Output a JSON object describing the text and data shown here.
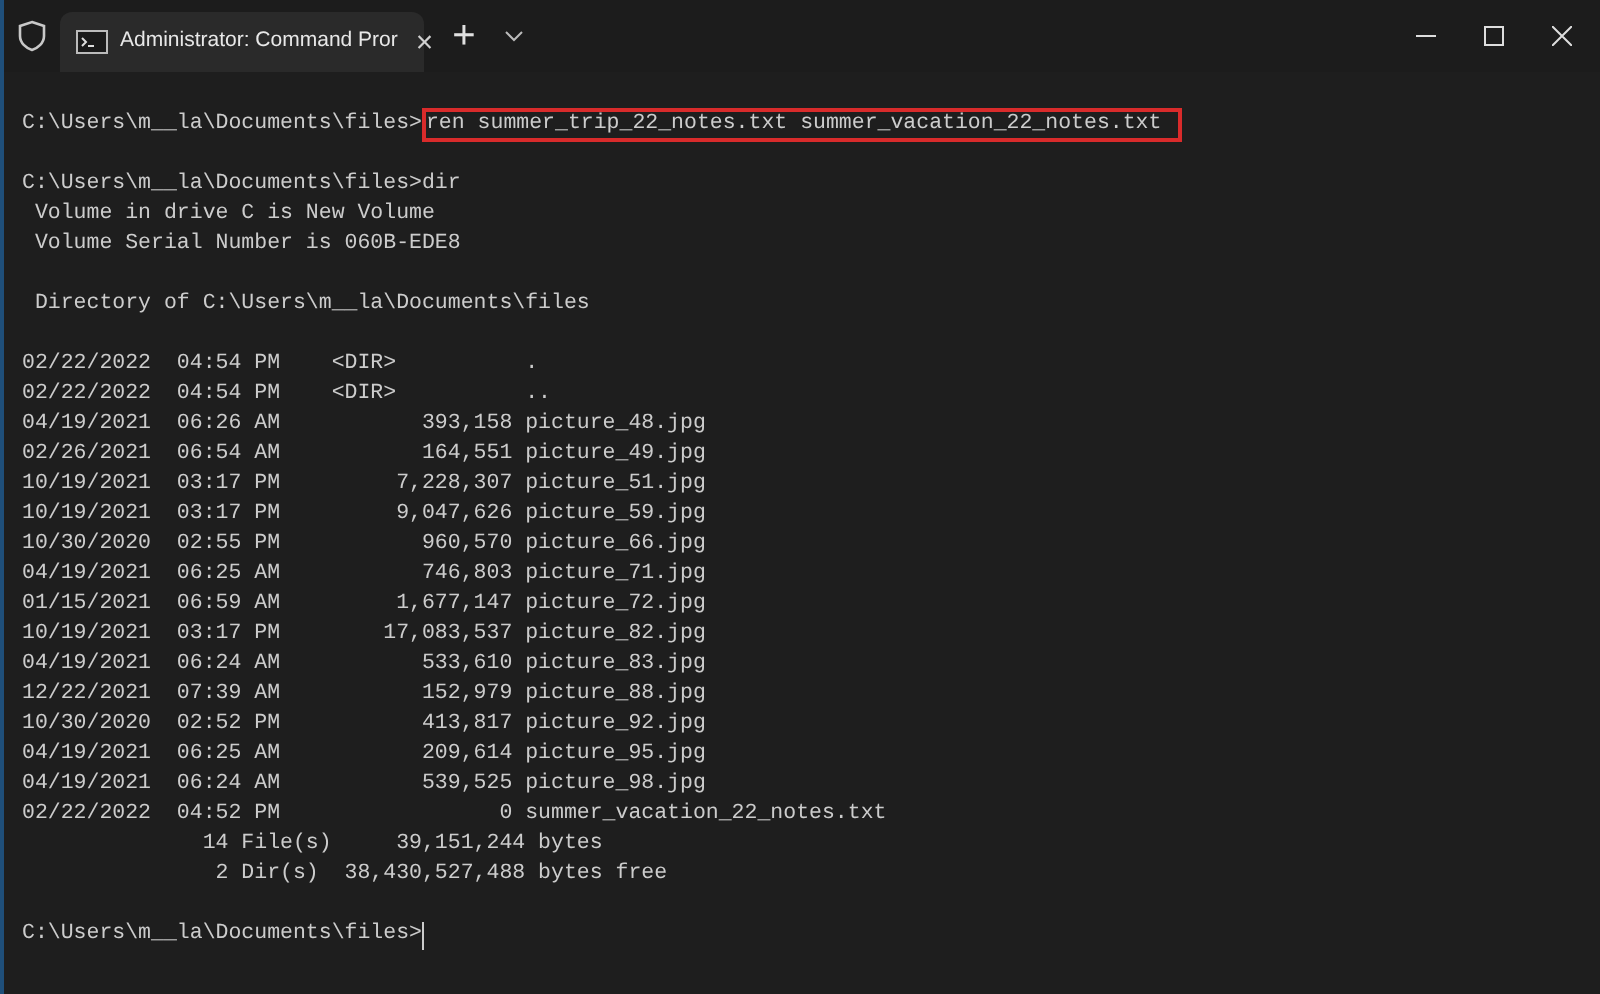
{
  "window": {
    "tab_title": "Administrator: Command Pror",
    "tab_close": "×",
    "new_tab": "+"
  },
  "lines": [
    {
      "kind": "blank"
    },
    {
      "kind": "prompt",
      "prompt": "C:\\Users\\m__la\\Documents\\files>",
      "command": "ren summer_trip_22_notes.txt summer_vacation_22_notes.txt",
      "highlighted": true
    },
    {
      "kind": "blank"
    },
    {
      "kind": "prompt",
      "prompt": "C:\\Users\\m__la\\Documents\\files>",
      "command": "dir"
    },
    {
      "kind": "output",
      "text": " Volume in drive C is New Volume"
    },
    {
      "kind": "output",
      "text": " Volume Serial Number is 060B-EDE8"
    },
    {
      "kind": "blank"
    },
    {
      "kind": "output",
      "text": " Directory of C:\\Users\\m__la\\Documents\\files"
    },
    {
      "kind": "blank"
    },
    {
      "kind": "output",
      "text": "02/22/2022  04:54 PM    <DIR>          ."
    },
    {
      "kind": "output",
      "text": "02/22/2022  04:54 PM    <DIR>          .."
    },
    {
      "kind": "output",
      "text": "04/19/2021  06:26 AM           393,158 picture_48.jpg"
    },
    {
      "kind": "output",
      "text": "02/26/2021  06:54 AM           164,551 picture_49.jpg"
    },
    {
      "kind": "output",
      "text": "10/19/2021  03:17 PM         7,228,307 picture_51.jpg"
    },
    {
      "kind": "output",
      "text": "10/19/2021  03:17 PM         9,047,626 picture_59.jpg"
    },
    {
      "kind": "output",
      "text": "10/30/2020  02:55 PM           960,570 picture_66.jpg"
    },
    {
      "kind": "output",
      "text": "04/19/2021  06:25 AM           746,803 picture_71.jpg"
    },
    {
      "kind": "output",
      "text": "01/15/2021  06:59 AM         1,677,147 picture_72.jpg"
    },
    {
      "kind": "output",
      "text": "10/19/2021  03:17 PM        17,083,537 picture_82.jpg"
    },
    {
      "kind": "output",
      "text": "04/19/2021  06:24 AM           533,610 picture_83.jpg"
    },
    {
      "kind": "output",
      "text": "12/22/2021  07:39 AM           152,979 picture_88.jpg"
    },
    {
      "kind": "output",
      "text": "10/30/2020  02:52 PM           413,817 picture_92.jpg"
    },
    {
      "kind": "output",
      "text": "04/19/2021  06:25 AM           209,614 picture_95.jpg"
    },
    {
      "kind": "output",
      "text": "04/19/2021  06:24 AM           539,525 picture_98.jpg"
    },
    {
      "kind": "output",
      "text": "02/22/2022  04:52 PM                 0 summer_vacation_22_notes.txt"
    },
    {
      "kind": "output",
      "text": "              14 File(s)     39,151,244 bytes"
    },
    {
      "kind": "output",
      "text": "               2 Dir(s)  38,430,527,488 bytes free"
    },
    {
      "kind": "blank"
    },
    {
      "kind": "prompt",
      "prompt": "C:\\Users\\m__la\\Documents\\files>",
      "cursor": true
    }
  ]
}
